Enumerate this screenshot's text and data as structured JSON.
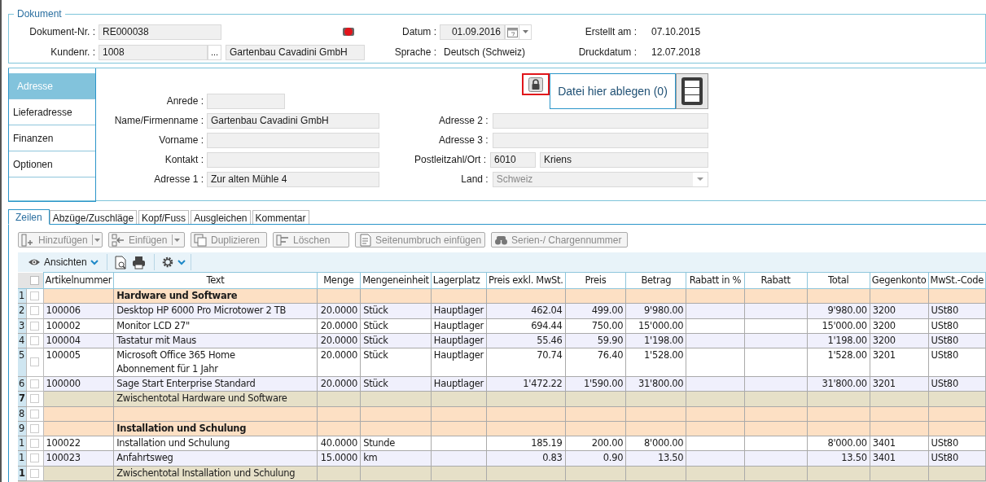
{
  "document": {
    "legend": "Dokument",
    "doc_no": {
      "label": "Dokument-Nr. :",
      "value": "RE000038"
    },
    "customer_no": {
      "label": "Kundenr. :",
      "value": "1008",
      "browse": "...",
      "name": "Gartenbau Cavadini GmbH"
    },
    "date": {
      "label": "Datum :",
      "value": "01.09.2016"
    },
    "language": {
      "label": "Sprache :",
      "value": "Deutsch (Schweiz)"
    },
    "created": {
      "label": "Erstellt am :",
      "value": "07.10.2015"
    },
    "printed": {
      "label": "Druckdatum :",
      "value": "12.07.2018"
    }
  },
  "sidebar": {
    "items": [
      {
        "label": "Adresse",
        "selected": true
      },
      {
        "label": "Lieferadresse",
        "selected": false
      },
      {
        "label": "Finanzen",
        "selected": false
      },
      {
        "label": "Optionen",
        "selected": false
      }
    ]
  },
  "address": {
    "left": [
      {
        "label": "Anrede :",
        "short": true
      },
      {
        "label": "Name/Firmenname :",
        "value": "Gartenbau Cavadini GmbH",
        "short": false
      },
      {
        "label": "Vorname :",
        "short": false
      },
      {
        "label": "Kontakt :",
        "short": false
      },
      {
        "label": "Adresse 1 :",
        "value": "Zur alten Mühle 4",
        "short": false
      }
    ],
    "right": [
      {
        "label": "Adresse 2 :",
        "kind": "text"
      },
      {
        "label": "Adresse 3 :",
        "kind": "text"
      },
      {
        "label": "Postleitzahl/Ort :",
        "kind": "zip",
        "zip": "6010",
        "city": "Kriens"
      },
      {
        "label": "Land :",
        "kind": "select",
        "value": "Schweiz",
        "disabled": true
      }
    ],
    "drop_zone": {
      "text": "Datei hier ablegen (0)",
      "locked": true
    }
  },
  "tabs": [
    {
      "label": "Zeilen",
      "selected": true
    },
    {
      "label": "Abzüge/Zuschläge",
      "selected": false
    },
    {
      "label": "Kopf/Fuss",
      "selected": false
    },
    {
      "label": "Ausgleichen",
      "selected": false
    },
    {
      "label": "Kommentar",
      "selected": false
    }
  ],
  "toolbar": [
    {
      "label": "Hinzufügen",
      "split": true,
      "disabled": true
    },
    {
      "label": "Einfügen",
      "split": true,
      "disabled": true
    },
    {
      "label": "Duplizieren",
      "split": false,
      "disabled": true
    },
    {
      "label": "Löschen",
      "split": false,
      "disabled": true
    },
    {
      "label": "Seitenumbruch einfügen",
      "split": false,
      "disabled": true
    },
    {
      "label": "Serien-/ Chargennummer",
      "split": false,
      "disabled": true
    }
  ],
  "grid_toolbar": {
    "views": "Ansichten"
  },
  "table": {
    "header_checked": false,
    "columns": [
      "Artikelnummer",
      "Text",
      "Menge",
      "Mengeneinheit",
      "Lagerplatz",
      "Preis exkl. MwSt.",
      "Preis",
      "Betrag",
      "Rabatt in %",
      "Rabatt",
      "Total",
      "Gegenkonto",
      "MwSt.-Code"
    ],
    "rows": [
      {
        "num": "1",
        "kind": "group",
        "checked": false,
        "cells": [
          "",
          "Hardware und Software",
          "",
          "",
          "",
          "",
          "",
          "",
          "",
          "",
          "",
          "",
          ""
        ]
      },
      {
        "num": "2",
        "kind": "item",
        "checked": false,
        "cells": [
          "100006",
          "Desktop HP 6000 Pro Microtower 2 TB",
          "20.0000",
          "Stück",
          "Hauptlager",
          "462.04",
          "499.00",
          "9'980.00",
          "",
          "",
          "9'980.00",
          "3200",
          "USt80"
        ]
      },
      {
        "num": "3",
        "kind": "item",
        "checked": false,
        "cells": [
          "100002",
          "Monitor LCD 27\"",
          "20.0000",
          "Stück",
          "Hauptlager",
          "694.44",
          "750.00",
          "15'000.00",
          "",
          "",
          "15'000.00",
          "3200",
          "USt80"
        ]
      },
      {
        "num": "4",
        "kind": "item",
        "checked": false,
        "cells": [
          "100004",
          "Tastatur mit Maus",
          "20.0000",
          "Stück",
          "Hauptlager",
          "55.46",
          "59.90",
          "1'198.00",
          "",
          "",
          "1'198.00",
          "3200",
          "USt80"
        ]
      },
      {
        "num": "5",
        "kind": "item",
        "checked": false,
        "cells": [
          "100005",
          "Microsoft Office 365 Home\nAbonnement für 1 Jahr",
          "20.0000",
          "Stück",
          "Hauptlager",
          "70.74",
          "76.40",
          "1'528.00",
          "",
          "",
          "1'528.00",
          "3201",
          "USt80"
        ]
      },
      {
        "num": "6",
        "kind": "item",
        "checked": false,
        "cells": [
          "100000",
          "Sage Start Enterprise Standard",
          "20.0000",
          "Stück",
          "Hauptlager",
          "1'472.22",
          "1'590.00",
          "31'800.00",
          "",
          "",
          "31'800.00",
          "3201",
          "USt80"
        ]
      },
      {
        "num": "7",
        "kind": "subtotal",
        "checked": false,
        "cells": [
          "",
          "Zwischentotal Hardware und Software",
          "",
          "",
          "",
          "",
          "",
          "",
          "",
          "",
          "",
          "",
          ""
        ]
      },
      {
        "num": "8",
        "kind": "empty",
        "checked": false,
        "cells": [
          "",
          "",
          "",
          "",
          "",
          "",
          "",
          "",
          "",
          "",
          "",
          "",
          ""
        ]
      },
      {
        "num": "9",
        "kind": "group",
        "checked": false,
        "cells": [
          "",
          "Installation und Schulung",
          "",
          "",
          "",
          "",
          "",
          "",
          "",
          "",
          "",
          "",
          ""
        ]
      },
      {
        "num": "1",
        "kind": "item",
        "checked": false,
        "cells": [
          "100022",
          "Installation und Schulung",
          "40.0000",
          "Stunde",
          "",
          "185.19",
          "200.00",
          "8'000.00",
          "",
          "",
          "8'000.00",
          "3401",
          "USt80"
        ]
      },
      {
        "num": "1",
        "kind": "item",
        "checked": false,
        "cells": [
          "100023",
          "Anfahrtsweg",
          "15.0000",
          "km",
          "",
          "0.83",
          "0.90",
          "13.50",
          "",
          "",
          "13.50",
          "3401",
          "USt80"
        ]
      },
      {
        "num": "1",
        "kind": "subtotal",
        "checked": false,
        "cells": [
          "",
          "Zwischentotal Installation und Schulung",
          "",
          "",
          "",
          "",
          "",
          "",
          "",
          "",
          "",
          "",
          ""
        ]
      }
    ]
  }
}
